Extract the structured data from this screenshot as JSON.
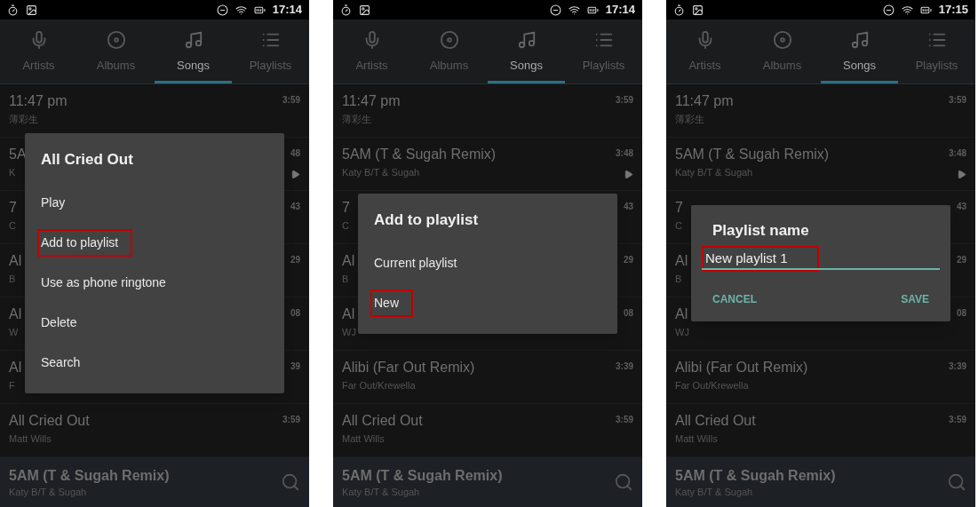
{
  "phones": [
    {
      "status_bar": {
        "time": "17:14"
      },
      "tabs": [
        {
          "label": "Artists",
          "selected": false
        },
        {
          "label": "Albums",
          "selected": false
        },
        {
          "label": "Songs",
          "selected": true
        },
        {
          "label": "Playlists",
          "selected": false
        }
      ],
      "rows": [
        {
          "title": "11:47 pm",
          "artist": "薄彩生",
          "duration": "3:59",
          "playing": false
        },
        {
          "title": "5A",
          "artist": "K",
          "duration": "48",
          "playing": true
        },
        {
          "title": "7",
          "artist": "C",
          "duration": "43",
          "playing": false
        },
        {
          "title": "Al",
          "artist": "B",
          "duration": "29",
          "playing": false
        },
        {
          "title": "Al",
          "artist": "W",
          "duration": "08",
          "playing": false
        },
        {
          "title": "Al",
          "artist": "F",
          "duration": "39",
          "playing": false
        },
        {
          "title": "All Cried Out",
          "artist": "Matt Wills",
          "duration": "3:59",
          "playing": false
        }
      ],
      "now_playing": {
        "title": "5AM (T & Sugah Remix)",
        "artist": "Katy B/T & Sugah"
      },
      "dialog": {
        "kind": "menu",
        "title": "All Cried Out",
        "items": [
          {
            "label": "Play",
            "highlighted": false
          },
          {
            "label": "Add to playlist",
            "highlighted": true
          },
          {
            "label": "Use as phone ringtone",
            "highlighted": false
          },
          {
            "label": "Delete",
            "highlighted": false
          },
          {
            "label": "Search",
            "highlighted": false
          }
        ]
      }
    },
    {
      "status_bar": {
        "time": "17:14"
      },
      "tabs": [
        {
          "label": "Artists",
          "selected": false
        },
        {
          "label": "Albums",
          "selected": false
        },
        {
          "label": "Songs",
          "selected": true
        },
        {
          "label": "Playlists",
          "selected": false
        }
      ],
      "rows": [
        {
          "title": "11:47 pm",
          "artist": "薄彩生",
          "duration": "3:59",
          "playing": false
        },
        {
          "title": "5AM (T & Sugah Remix)",
          "artist": "Katy B/T & Sugah",
          "duration": "3:48",
          "playing": true
        },
        {
          "title": "7",
          "artist": "C",
          "duration": "43",
          "playing": false
        },
        {
          "title": "Al",
          "artist": "B",
          "duration": "29",
          "playing": false
        },
        {
          "title": "Al",
          "artist": "WJ",
          "duration": "08",
          "playing": false
        },
        {
          "title": "Alibi (Far Out Remix)",
          "artist": "Far Out/Krewella",
          "duration": "3:39",
          "playing": false
        },
        {
          "title": "All Cried Out",
          "artist": "Matt Wills",
          "duration": "3:59",
          "playing": false
        }
      ],
      "now_playing": {
        "title": "5AM (T & Sugah Remix)",
        "artist": "Katy B/T & Sugah"
      },
      "dialog": {
        "kind": "menu",
        "title": "Add to playlist",
        "items": [
          {
            "label": "Current playlist",
            "highlighted": false
          },
          {
            "label": "New",
            "highlighted": true
          }
        ]
      }
    },
    {
      "status_bar": {
        "time": "17:15"
      },
      "tabs": [
        {
          "label": "Artists",
          "selected": false
        },
        {
          "label": "Albums",
          "selected": false
        },
        {
          "label": "Songs",
          "selected": true
        },
        {
          "label": "Playlists",
          "selected": false
        }
      ],
      "rows": [
        {
          "title": "11:47 pm",
          "artist": "薄彩生",
          "duration": "3:59",
          "playing": false
        },
        {
          "title": "5AM (T & Sugah Remix)",
          "artist": "Katy B/T & Sugah",
          "duration": "3:48",
          "playing": true
        },
        {
          "title": "7",
          "artist": "C",
          "duration": "43",
          "playing": false
        },
        {
          "title": "Al",
          "artist": "B",
          "duration": "29",
          "playing": false
        },
        {
          "title": "Al",
          "artist": "WJ",
          "duration": "08",
          "playing": false
        },
        {
          "title": "Alibi (Far Out Remix)",
          "artist": "Far Out/Krewella",
          "duration": "3:39",
          "playing": false
        },
        {
          "title": "All Cried Out",
          "artist": "Matt Wills",
          "duration": "3:59",
          "playing": false
        }
      ],
      "now_playing": {
        "title": "5AM (T & Sugah Remix)",
        "artist": "Katy B/T & Sugah"
      },
      "dialog": {
        "kind": "prompt",
        "title": "Playlist name",
        "value": "New playlist 1",
        "highlighted": true,
        "buttons": [
          "CANCEL",
          "SAVE"
        ]
      }
    }
  ]
}
